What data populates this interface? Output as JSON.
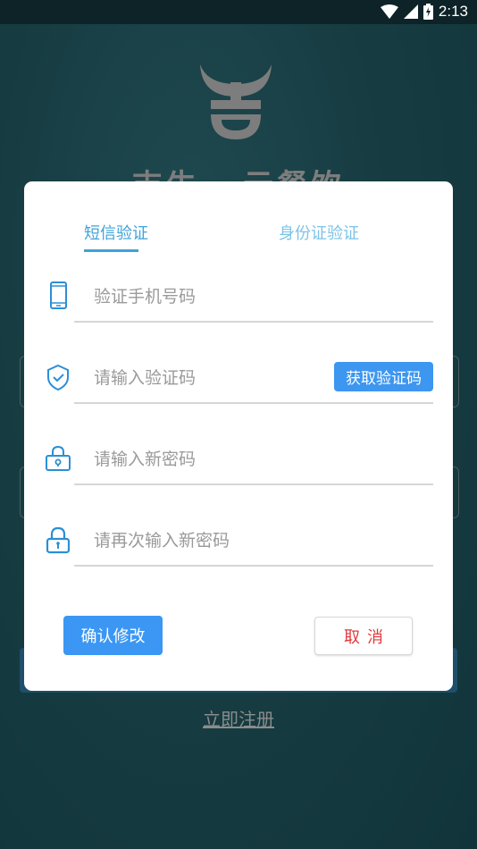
{
  "status_bar": {
    "time": "2:13",
    "icons": [
      "wifi-icon",
      "signal-icon",
      "battery-charging-icon"
    ]
  },
  "background": {
    "app_title": "吉牛 · 云餐饮",
    "register_link": "立即注册"
  },
  "dialog": {
    "tabs": [
      {
        "label": "短信验证",
        "active": true
      },
      {
        "label": "身份证验证",
        "active": false
      }
    ],
    "fields": [
      {
        "icon": "phone-icon",
        "placeholder": "验证手机号码",
        "value": ""
      },
      {
        "icon": "shield-check-icon",
        "placeholder": "请输入验证码",
        "value": ""
      },
      {
        "icon": "lock-keyhole-icon",
        "placeholder": "请输入新密码",
        "value": ""
      },
      {
        "icon": "lock-icon",
        "placeholder": "请再次输入新密码",
        "value": ""
      }
    ],
    "get_code_label": "获取验证码",
    "confirm_label": "确认修改",
    "cancel_label": "取消"
  },
  "colors": {
    "accent": "#3b97f3",
    "tab_active": "#3fa3d9",
    "cancel_text": "#e0393b",
    "background": "#173d43"
  }
}
